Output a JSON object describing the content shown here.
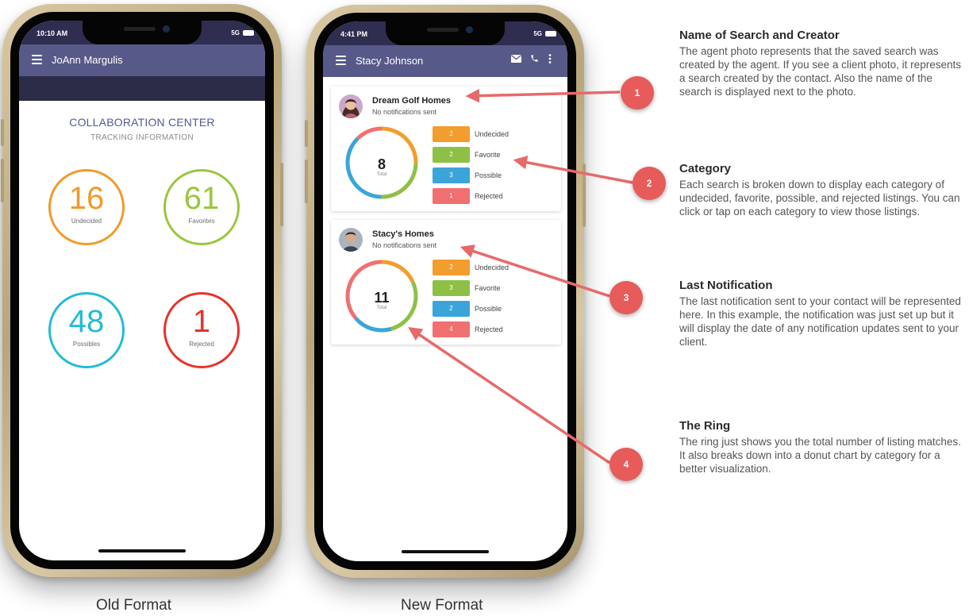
{
  "colors": {
    "undecided": "#f29d2d",
    "favorite": "#8fc046",
    "possible": "#3ba5d9",
    "rejected": "#f07070",
    "old_undecided": "#f29a28",
    "old_favorite": "#99c73c",
    "old_possible": "#22bcd4",
    "old_rejected": "#e5332a",
    "badge": "#e75b5b",
    "arrow": "#e66a6a",
    "header": "#575989"
  },
  "old_format": {
    "status_time": "10:10 AM",
    "status_network": "5G",
    "user_name": "JoAnn Margulis",
    "title": "COLLABORATION CENTER",
    "subtitle": "TRACKING INFORMATION",
    "stats": [
      {
        "value": "16",
        "label": "Undecided"
      },
      {
        "value": "61",
        "label": "Favorites"
      },
      {
        "value": "48",
        "label": "Possibles"
      },
      {
        "value": "1",
        "label": "Rejected"
      }
    ],
    "caption": "Old Format"
  },
  "new_format": {
    "status_time": "4:41 PM",
    "status_network": "5G",
    "user_name": "Stacy Johnson",
    "header_icons": [
      "mail-icon",
      "phone-icon",
      "more-vert-icon"
    ],
    "total_label": "Total",
    "searches": [
      {
        "name": "Dream Golf Homes",
        "notification": "No notifications sent",
        "total": "8",
        "categories": [
          {
            "label": "Undecided",
            "count": "2"
          },
          {
            "label": "Favorite",
            "count": "2"
          },
          {
            "label": "Possible",
            "count": "3"
          },
          {
            "label": "Rejected",
            "count": "1"
          }
        ]
      },
      {
        "name": "Stacy's Homes",
        "notification": "No notifications sent",
        "total": "11",
        "categories": [
          {
            "label": "Undecided",
            "count": "2"
          },
          {
            "label": "Favorite",
            "count": "3"
          },
          {
            "label": "Possible",
            "count": "2"
          },
          {
            "label": "Rejected",
            "count": "4"
          }
        ]
      }
    ],
    "caption": "New Format"
  },
  "annotations": [
    {
      "number": "1",
      "title": "Name of Search and Creator",
      "body": "The agent photo represents that the saved search was created by the agent.  If you see a client photo, it represents a search created by the contact.  Also the name of the search is displayed next to the photo."
    },
    {
      "number": "2",
      "title": "Category",
      "body": "Each search is broken down to display each category  of undecided, favorite, possible, and rejected listings.  You can click or tap on each category to view those listings."
    },
    {
      "number": "3",
      "title": "Last Notification",
      "body": "The last notification sent to your contact will be represented here.  In this example, the notification was just set up but it will display the date of any notification updates sent to your client."
    },
    {
      "number": "4",
      "title": "The Ring",
      "body": "The ring just shows you the total number of listing matches.  It also breaks down into a donut chart by category for a better visualization."
    }
  ]
}
